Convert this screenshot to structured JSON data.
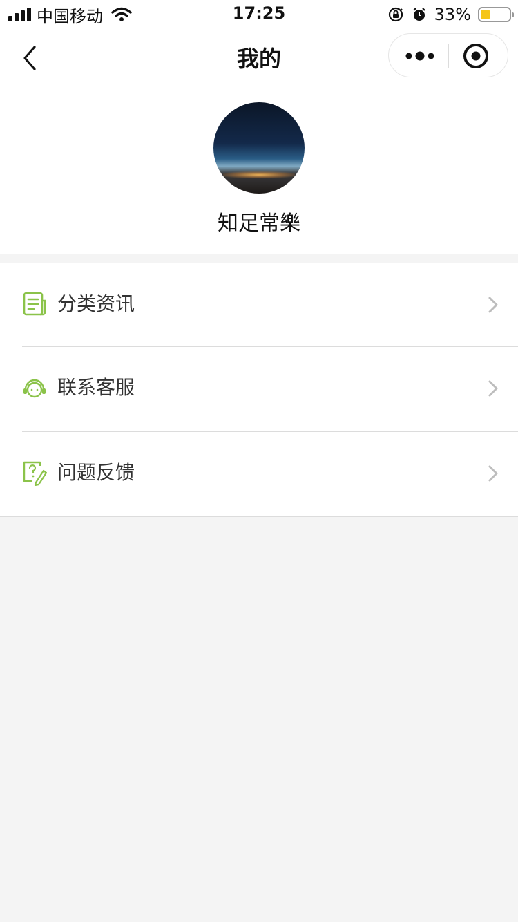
{
  "status_bar": {
    "carrier": "中国移动",
    "time": "17:25",
    "battery_percent": "33%",
    "battery_level": 0.33,
    "icons": [
      "signal-icon",
      "wifi-icon",
      "orientation-lock-icon",
      "alarm-icon",
      "battery-icon"
    ]
  },
  "nav": {
    "title": "我的",
    "back_icon": "back-arrow-icon",
    "more_icon": "more-dots-icon",
    "close_icon": "target-close-icon"
  },
  "profile": {
    "name": "知足常樂",
    "avatar_icon": "night-sky-avatar"
  },
  "menu": {
    "items": [
      {
        "label": "分类资讯",
        "icon": "document-icon"
      },
      {
        "label": "联系客服",
        "icon": "customer-service-icon"
      },
      {
        "label": "问题反馈",
        "icon": "feedback-icon"
      }
    ]
  },
  "colors": {
    "accent_green": "#8bc34a",
    "battery_yellow": "#f5c518",
    "page_background": "#f4f4f4"
  }
}
